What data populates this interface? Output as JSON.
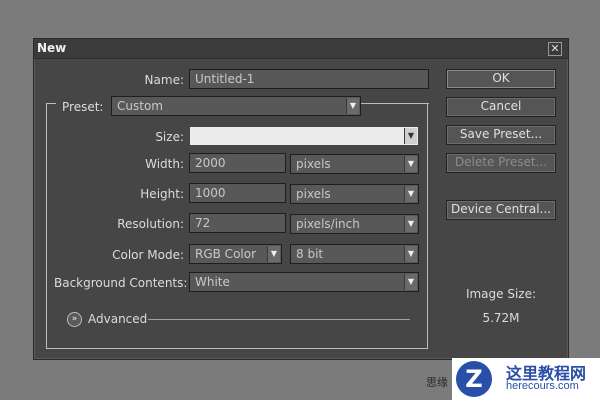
{
  "dialog": {
    "title": "New",
    "close_glyph": "✕"
  },
  "form": {
    "name_label": "Name:",
    "name_value": "Untitled-1",
    "preset_label": "Preset:",
    "preset_value": "Custom",
    "size_label": "Size:",
    "size_value": "",
    "width_label": "Width:",
    "width_value": "2000",
    "width_unit": "pixels",
    "height_label": "Height:",
    "height_value": "1000",
    "height_unit": "pixels",
    "resolution_label": "Resolution:",
    "resolution_value": "72",
    "resolution_unit": "pixels/inch",
    "color_mode_label": "Color Mode:",
    "color_mode_value": "RGB Color",
    "bit_depth_value": "8 bit",
    "background_label": "Background Contents:",
    "background_value": "White",
    "advanced_label": "Advanced"
  },
  "buttons": {
    "ok": "OK",
    "cancel": "Cancel",
    "save_preset": "Save Preset...",
    "delete_preset": "Delete Preset...",
    "device_central": "Device Central..."
  },
  "image_size": {
    "label": "Image Size:",
    "value": "5.72M"
  },
  "watermark": {
    "logo_letter": "Z",
    "cn_text": "这里教程网",
    "url": "herecours.com",
    "side_text": "思缘"
  },
  "icons": {
    "dropdown": "chevron-down-icon",
    "close": "close-icon",
    "advanced": "double-chevron-down-icon"
  },
  "colors": {
    "background": "#7b7b7b",
    "dialog": "#464646",
    "field": "#585858",
    "brand": "#2a4fa8"
  }
}
